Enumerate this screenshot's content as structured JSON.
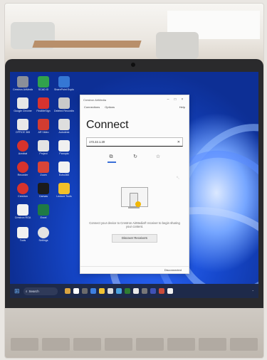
{
  "app": {
    "window_title": "Crestron AirMedia",
    "menu": {
      "items": [
        "Connections",
        "Options"
      ],
      "help": "Help"
    },
    "heading": "Connect",
    "address_value": "172.22.1.20",
    "description": "Connect your device to Crestron AirMedia® receiver to begin sharing your content.",
    "discover_label": "Discover Receivers",
    "status": "Disconnected",
    "window_controls": [
      "–",
      "□",
      "×"
    ]
  },
  "taskbar": {
    "search_label": "Search"
  },
  "icons": {
    "clear": "close-icon",
    "modes": [
      "cast-icon",
      "refresh-icon",
      "star-icon"
    ]
  },
  "desktop": {
    "icons": [
      {
        "label": "Crestron AirMedia"
      },
      {
        "label": "SCAD ID"
      },
      {
        "label": "SharePoint Explorer"
      },
      {
        "label": "Google Chrome"
      },
      {
        "label": "FindMeSign"
      },
      {
        "label": "Deleted Recording"
      },
      {
        "label": "OFFICE 365"
      },
      {
        "label": "AR Video"
      },
      {
        "label": "Autodesk"
      },
      {
        "label": "Acrobat"
      },
      {
        "label": "Project"
      },
      {
        "label": "Panopto"
      },
      {
        "label": "Recorder"
      },
      {
        "label": "Zoom"
      },
      {
        "label": "Echo360"
      },
      {
        "label": "Crestron"
      },
      {
        "label": "Canvas"
      },
      {
        "label": "Lecture Tools"
      },
      {
        "label": "Crestron RGA"
      },
      {
        "label": "Excel"
      },
      {
        "label": "Settings"
      },
      {
        "label": "Tools"
      },
      {
        "label": "Settings"
      }
    ]
  },
  "colors": {
    "accent": "#3a6fd8",
    "badge": "#f2b705"
  }
}
